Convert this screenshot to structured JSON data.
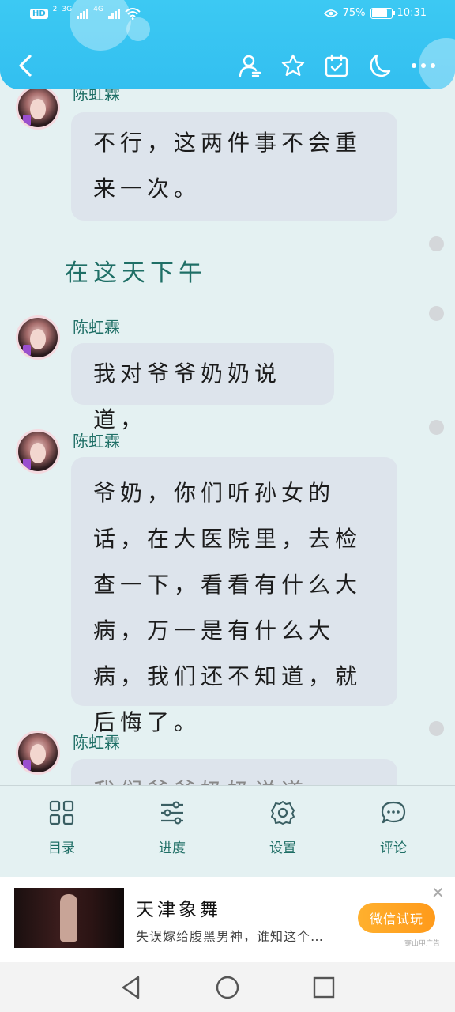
{
  "status_bar": {
    "hd": "HD",
    "sim": "2",
    "net1": "3G",
    "net2": "4G",
    "battery_text": "75%",
    "battery_level": 0.75,
    "time": "10:31"
  },
  "toolbar": {
    "icons": [
      "back-icon",
      "author-icon",
      "star-icon",
      "calendar-check-icon",
      "moon-icon",
      "more-icon"
    ]
  },
  "messages": [
    {
      "name": "陈虹霖",
      "text": "不行，这两件事不会重来一次。"
    },
    {
      "name": "陈虹霖",
      "text": "我对爷爷奶奶说道，"
    },
    {
      "name": "陈虹霖",
      "text": "爷奶，你们听孙女的话，在大医院里，去检查一下，看看有什么大病，万一是有什么大病，我们还不知道，就后悔了。"
    },
    {
      "name": "陈虹霖",
      "text": "我们爷爷奶奶说道……"
    }
  ],
  "narration": "在这天下午",
  "bottom_menu": [
    {
      "label": "目录",
      "icon": "grid-icon"
    },
    {
      "label": "进度",
      "icon": "sliders-icon"
    },
    {
      "label": "设置",
      "icon": "gear-icon"
    },
    {
      "label": "评论",
      "icon": "comment-icon"
    }
  ],
  "ad": {
    "title": "天津象舞",
    "description": "失误嫁给腹黑男神，谁知这个…",
    "button": "微信试玩",
    "source": "穿山甲广告",
    "close": "✕"
  }
}
